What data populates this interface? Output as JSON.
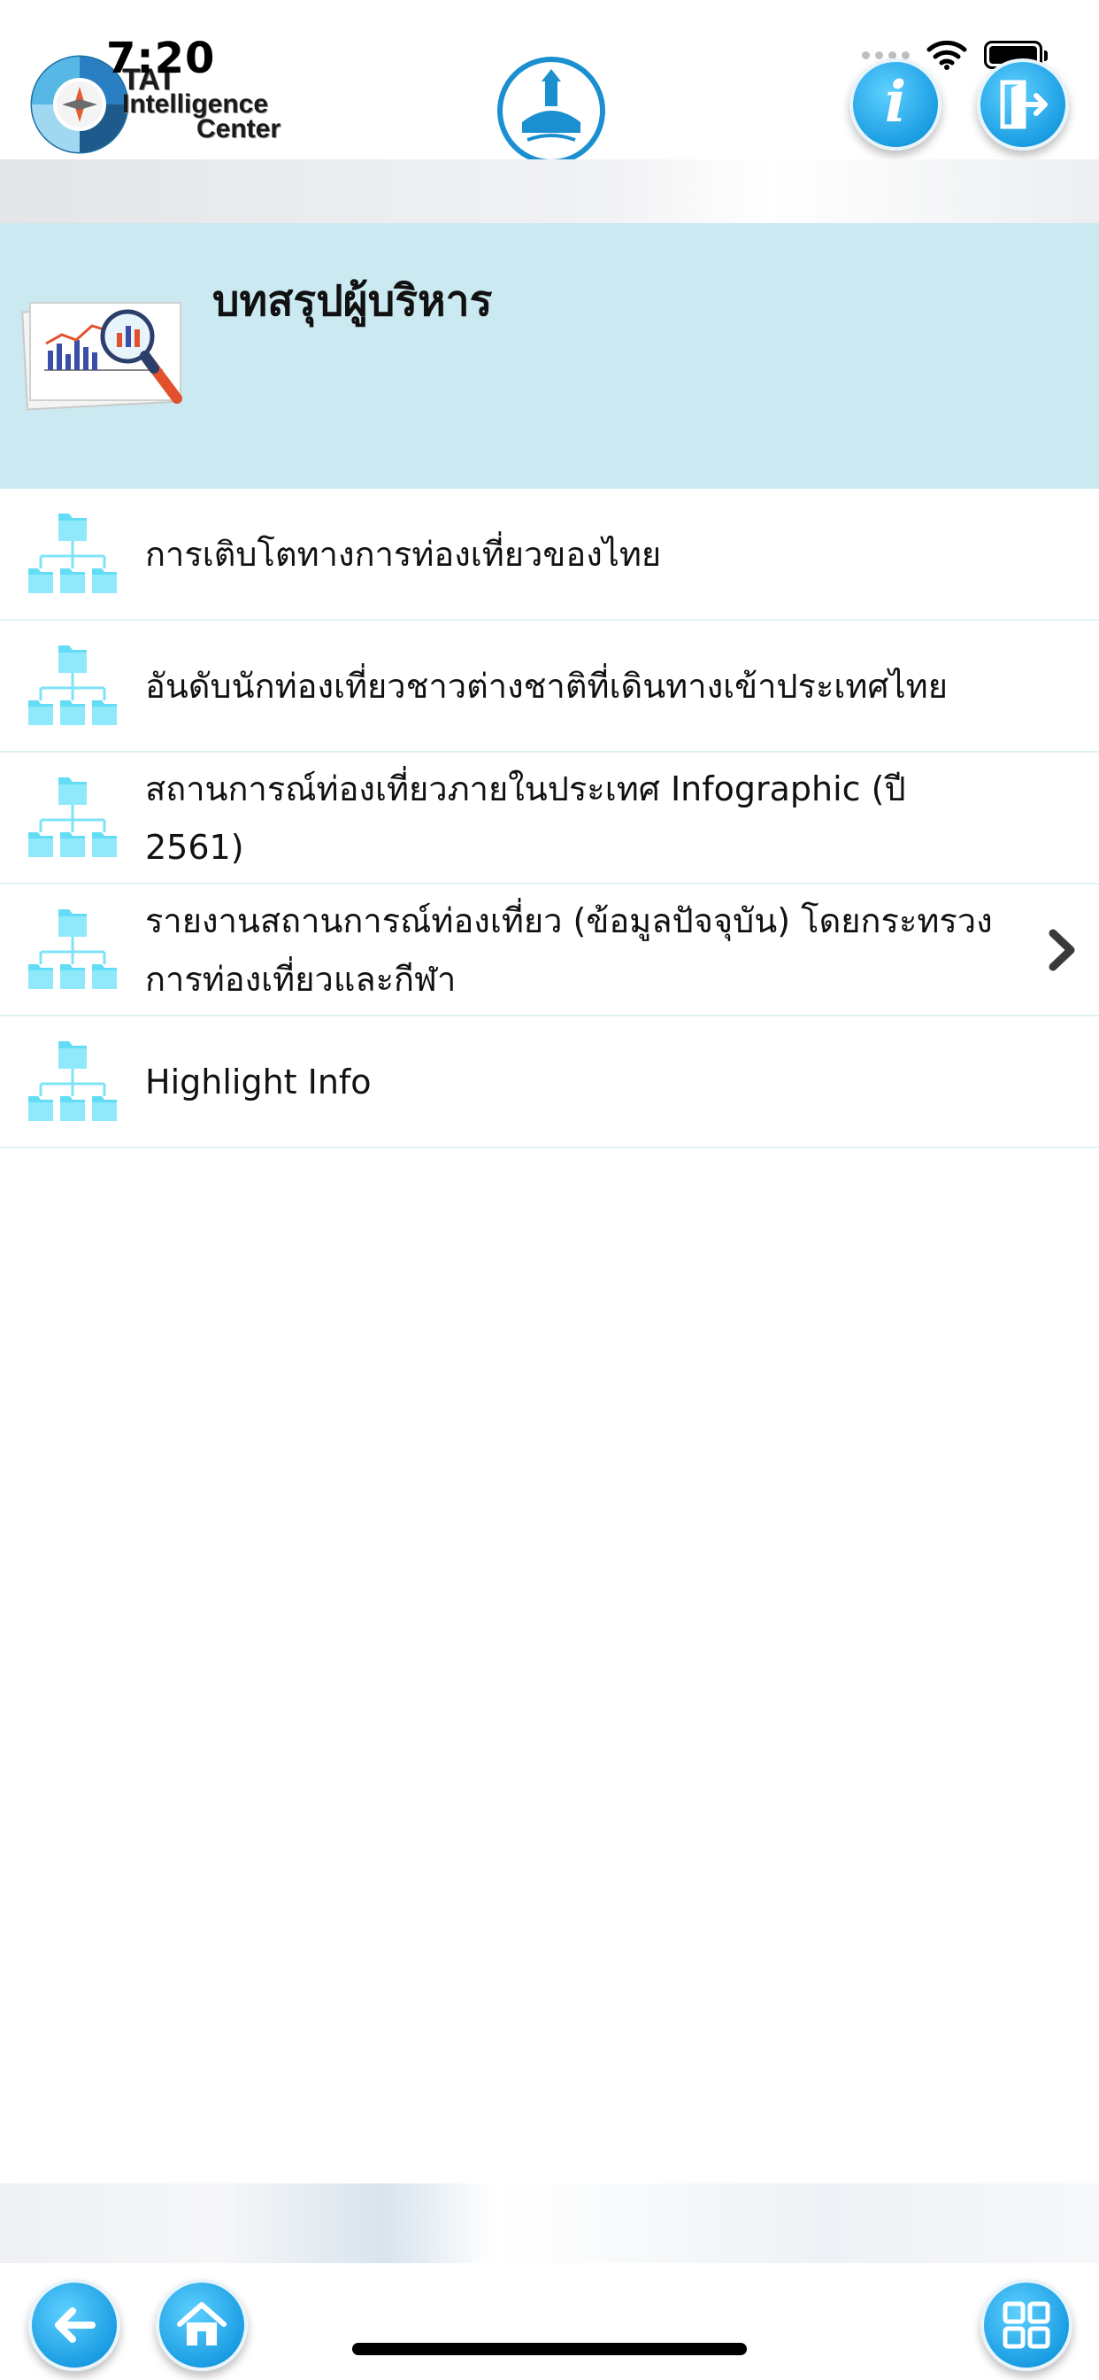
{
  "status_bar": {
    "time": "7:20"
  },
  "header": {
    "logo": {
      "line1": "TAT",
      "line2": "Intelligence",
      "line3": "Center"
    },
    "center_emblem": "tat-emblem",
    "info_button_glyph": "i"
  },
  "section": {
    "title": "บทสรุปผู้บริหาร",
    "illustration": "report-magnifier-icon"
  },
  "menu": {
    "items": [
      {
        "label": "การเติบโตทางการท่องเที่ยวของไทย",
        "icon": "folder-tree-icon"
      },
      {
        "label": "อันดับนักท่องเที่ยวชาวต่างชาติที่เดินทางเข้าประเทศไทย",
        "icon": "folder-tree-icon"
      },
      {
        "label": "สถานการณ์ท่องเที่ยวภายในประเทศ Infographic (ปี 2561)",
        "icon": "folder-tree-icon"
      },
      {
        "label": "รายงานสถานการณ์ท่องเที่ยว (ข้อมูลปัจจุบัน) โดยกระทรวงการท่องเที่ยวและกีฬา",
        "icon": "folder-tree-icon",
        "has_chevron": true
      },
      {
        "label": "Highlight Info",
        "icon": "folder-tree-icon"
      }
    ]
  },
  "footer": {
    "buttons": [
      "back-arrow-icon",
      "home-icon",
      "grid-icon"
    ]
  },
  "colors": {
    "accent": "#1b9ee3",
    "header_bg": "#cbe9f0",
    "divider": "#dff1f4",
    "folder": "#5fd8f5"
  }
}
